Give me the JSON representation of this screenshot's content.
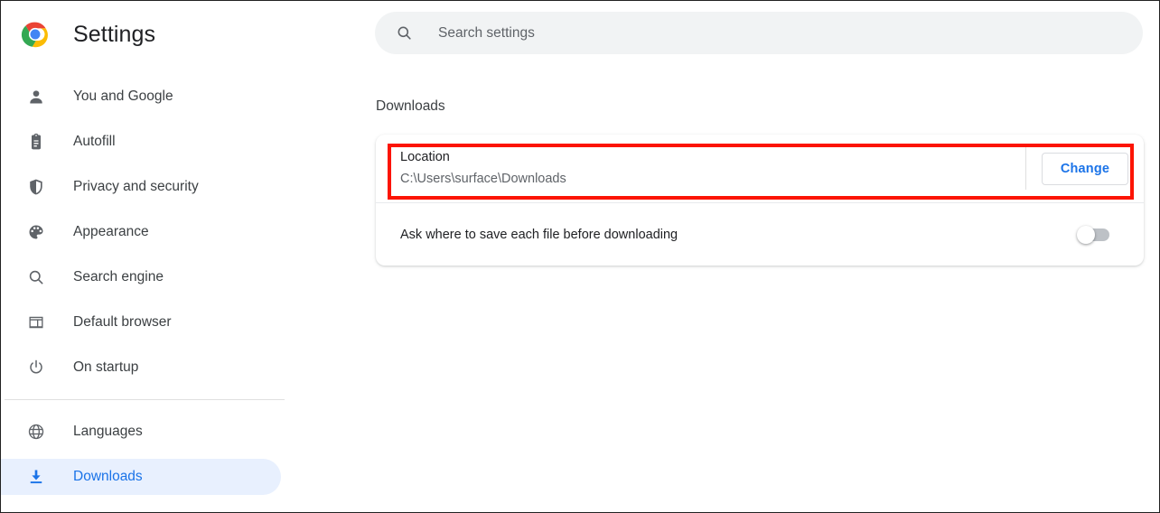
{
  "app": {
    "title": "Settings",
    "logo_icon": "chrome-logo"
  },
  "colors": {
    "accent": "#1a73e8",
    "selected_bg": "#e8f0fe",
    "text_primary": "#202124",
    "text_secondary": "#5f6368",
    "search_bg": "#f1f3f4",
    "annotation_red": "#fc1403"
  },
  "search": {
    "placeholder": "Search settings",
    "value": "",
    "icon": "search-icon"
  },
  "sidebar": {
    "groups": [
      {
        "items": [
          {
            "label": "You and Google",
            "icon": "person-icon",
            "selected": false
          },
          {
            "label": "Autofill",
            "icon": "clipboard-icon",
            "selected": false
          },
          {
            "label": "Privacy and security",
            "icon": "shield-icon",
            "selected": false
          },
          {
            "label": "Appearance",
            "icon": "palette-icon",
            "selected": false
          },
          {
            "label": "Search engine",
            "icon": "search-icon",
            "selected": false
          },
          {
            "label": "Default browser",
            "icon": "window-icon",
            "selected": false
          },
          {
            "label": "On startup",
            "icon": "power-icon",
            "selected": false
          }
        ]
      },
      {
        "items": [
          {
            "label": "Languages",
            "icon": "globe-icon",
            "selected": false
          },
          {
            "label": "Downloads",
            "icon": "download-icon",
            "selected": true
          }
        ]
      }
    ]
  },
  "main": {
    "section_title": "Downloads",
    "location_row": {
      "label": "Location",
      "value": "C:\\Users\\surface\\Downloads",
      "button_label": "Change"
    },
    "ask_row": {
      "label": "Ask where to save each file before downloading",
      "toggle_state": "off"
    }
  }
}
